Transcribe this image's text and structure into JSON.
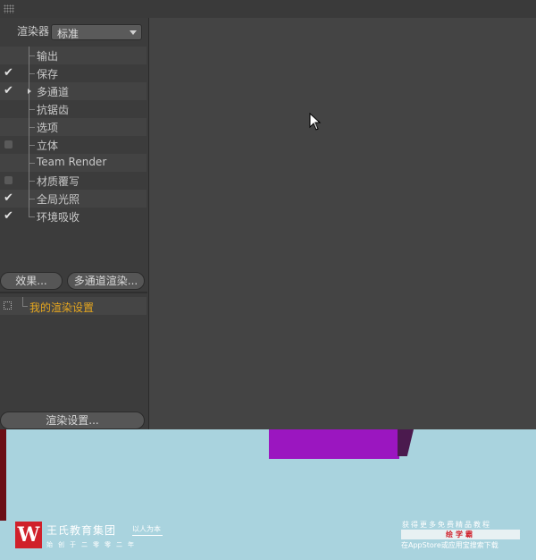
{
  "renderer": {
    "label": "渲染器",
    "value": "标准"
  },
  "tree": [
    {
      "label": "输出",
      "state": "none"
    },
    {
      "label": "保存",
      "state": "checked"
    },
    {
      "label": "多通道",
      "state": "checked"
    },
    {
      "label": "抗锯齿",
      "state": "none"
    },
    {
      "label": "选项",
      "state": "none"
    },
    {
      "label": "立体",
      "state": "unchecked"
    },
    {
      "label": "Team Render",
      "state": "none"
    },
    {
      "label": "材质覆写",
      "state": "unchecked"
    },
    {
      "label": "全局光照",
      "state": "checked"
    },
    {
      "label": "环境吸收",
      "state": "checked"
    }
  ],
  "buttons": {
    "effects": "效果...",
    "multipass": "多通道渲染...",
    "render_settings": "渲染设置..."
  },
  "settings": {
    "name": "我的渲染设置"
  },
  "watermark": {
    "logo_letter": "W",
    "name": "王氏教育集团",
    "motto": "以人为本",
    "slogan": "始创于二零零二年",
    "promo_top": "获得更多免费精品教程",
    "app_name": "绘学霸",
    "promo_bottom": "在AppStore或应用宝搜索下载"
  },
  "colors": {
    "accent": "#e8a81e",
    "purple": "#9b16c0",
    "brand_red": "#d0202a"
  }
}
